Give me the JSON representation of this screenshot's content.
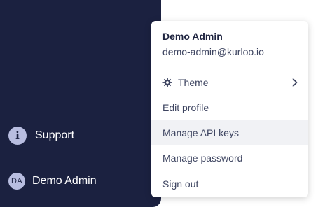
{
  "sidebar": {
    "support_label": "Support",
    "support_icon": "info-icon",
    "user_initials": "DA",
    "user_label": "Demo Admin"
  },
  "menu": {
    "user_name": "Demo Admin",
    "user_email": "demo-admin@kurloo.io",
    "items": [
      {
        "label": "Theme",
        "icon": "gear-icon",
        "has_submenu": true
      },
      {
        "label": "Edit profile"
      },
      {
        "label": "Manage API keys",
        "highlighted": true
      },
      {
        "label": "Manage password"
      },
      {
        "label": "Sign out"
      }
    ]
  },
  "colors": {
    "sidebar_bg": "#1b2140",
    "avatar_bg": "#b8bde0",
    "menu_text": "#3d4460",
    "hover_bg": "#f1f2f5"
  }
}
